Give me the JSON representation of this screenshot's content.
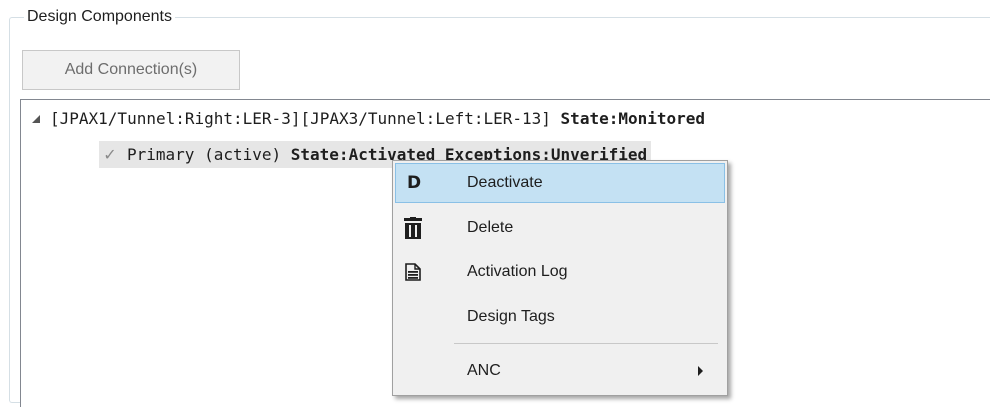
{
  "groupbox": {
    "title": "Design Components"
  },
  "toolbar": {
    "add_connection_label": "Add Connection(s)"
  },
  "tree": {
    "root": {
      "path": "[JPAX1/Tunnel:Right:LER-3][JPAX3/Tunnel:Left:LER-13]",
      "state": "State:Monitored",
      "expanded": true
    },
    "child": {
      "checked": true,
      "label": "Primary (active)",
      "state": "State:Activated Exceptions:Unverified"
    }
  },
  "context_menu": {
    "items": [
      {
        "label": "Deactivate",
        "icon": "deactivate-d-icon",
        "icon_text": "D",
        "highlighted": true
      },
      {
        "label": "Delete",
        "icon": "trash-icon"
      },
      {
        "label": "Activation Log",
        "icon": "document-icon"
      },
      {
        "label": "Design Tags",
        "icon": ""
      },
      {
        "label": "ANC",
        "icon": "",
        "has_submenu": true
      }
    ]
  },
  "colors": {
    "highlight_bg": "#c4e1f3",
    "highlight_border": "#8ac0e6",
    "menu_bg": "#f0f0f0"
  }
}
